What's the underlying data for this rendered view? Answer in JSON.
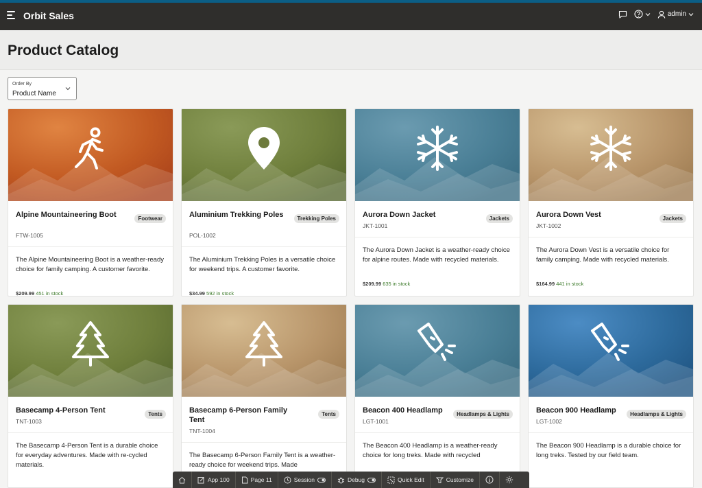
{
  "header": {
    "app_title": "Orbit Sales",
    "user": "admin",
    "icons": [
      "menu-icon",
      "chat-icon",
      "help-icon",
      "user-icon"
    ]
  },
  "page": {
    "title": "Product Catalog"
  },
  "order_by": {
    "label": "Order By",
    "value": "Product Name"
  },
  "colors": {
    "brand_stripe": "#0b5e86",
    "header_bg": "#2f2e2c",
    "stock_green": "#3c7a2a",
    "orange": "#c2541f",
    "olive": "#6d7a3c",
    "teal": "#4a7f96",
    "tan": "#b8956a",
    "blue": "#2d6a9c"
  },
  "products": [
    {
      "name": "Alpine Mountaineering Boot",
      "sku": "FTW-1005",
      "category": "Footwear",
      "icon": "hiker-icon",
      "theme": "orange",
      "description": "The Alpine Mountaineering Boot is a weather-ready choice for family camping. A customer favorite.",
      "price": "$209.99",
      "stock": "451 in stock"
    },
    {
      "name": "Aluminium Trekking Poles",
      "sku": "POL-1002",
      "category": "Trekking Poles",
      "icon": "map-pin-icon",
      "theme": "olive",
      "description": "The Aluminium Trekking Poles is a versatile choice for weekend trips. A customer favorite.",
      "price": "$34.99",
      "stock": "592 in stock"
    },
    {
      "name": "Aurora Down Jacket",
      "sku": "JKT-1001",
      "category": "Jackets",
      "icon": "snowflake-icon",
      "theme": "teal",
      "description": "The Aurora Down Jacket is a weather-ready choice for alpine routes. Made with recycled materials.",
      "price": "$209.99",
      "stock": "635 in stock"
    },
    {
      "name": "Aurora Down Vest",
      "sku": "JKT-1002",
      "category": "Jackets",
      "icon": "snowflake-icon",
      "theme": "tan",
      "description": "The Aurora Down Vest is a versatile choice for family camping. Made with recycled materials.",
      "price": "$164.99",
      "stock": "441 in stock"
    },
    {
      "name": "Basecamp 4-Person Tent",
      "sku": "TNT-1003",
      "category": "Tents",
      "icon": "tree-icon",
      "theme": "olive",
      "description": "The Basecamp 4-Person Tent is a durable choice for everyday adventures. Made with re-cycled materials.",
      "price": "",
      "stock": ""
    },
    {
      "name": "Basecamp 6-Person Family Tent",
      "sku": "TNT-1004",
      "category": "Tents",
      "icon": "tree-icon",
      "theme": "tan",
      "description": "The Basecamp 6-Person Family Tent is a weather-ready choice for weekend trips. Made",
      "price": "",
      "stock": ""
    },
    {
      "name": "Beacon 400 Headlamp",
      "sku": "LGT-1001",
      "category": "Headlamps & Lights",
      "icon": "flashlight-icon",
      "theme": "teal",
      "description": "The Beacon 400 Headlamp is a weather-ready choice for long treks. Made with recycled",
      "price": "",
      "stock": ""
    },
    {
      "name": "Beacon 900 Headlamp",
      "sku": "LGT-1002",
      "category": "Headlamps & Lights",
      "icon": "flashlight-icon",
      "theme": "blue",
      "description": "The Beacon 900 Headlamp is a durable choice for long treks. Tested by our field team.",
      "price": "",
      "stock": ""
    }
  ],
  "devbar": {
    "items": [
      {
        "label": "",
        "icon": "home-icon"
      },
      {
        "label": "App 100",
        "icon": "edit-icon"
      },
      {
        "label": "Page 11",
        "icon": "page-icon"
      },
      {
        "label": "Session",
        "icon": "session-icon"
      },
      {
        "label": "Debug",
        "icon": "bug-icon"
      },
      {
        "label": "Quick Edit",
        "icon": "quick-edit-icon"
      },
      {
        "label": "Customize",
        "icon": "customize-icon"
      },
      {
        "label": "",
        "icon": "info-icon"
      },
      {
        "label": "",
        "icon": "gear-icon"
      }
    ]
  }
}
